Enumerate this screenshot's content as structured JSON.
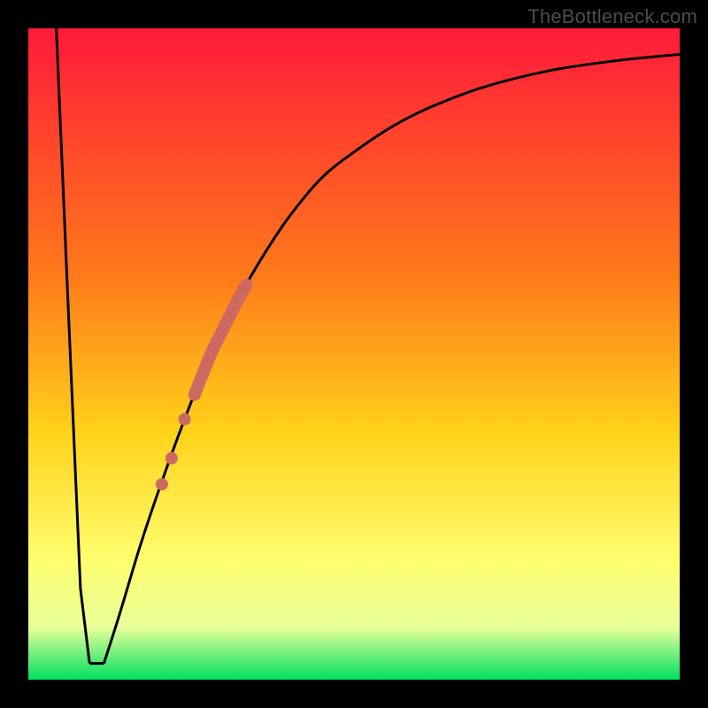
{
  "watermark": "TheBottleneck.com",
  "colors": {
    "frame": "#000000",
    "gradient_top": "#ff1a3a",
    "gradient_mid1": "#ff7a1a",
    "gradient_mid2": "#ffd21a",
    "gradient_mid3": "#ffff70",
    "gradient_mid4": "#e8ff9a",
    "gradient_bottom": "#00e060",
    "curve": "#000000",
    "markers": "#cc6a62"
  },
  "chart_data": {
    "type": "line",
    "title": "",
    "xlabel": "",
    "ylabel": "",
    "xlim": [
      0,
      100
    ],
    "ylim": [
      0,
      100
    ],
    "grid": false,
    "legend": false,
    "series": [
      {
        "name": "bottleneck_curve_left",
        "x": [
          4.3,
          6.0,
          8.0,
          9.4
        ],
        "values": [
          100,
          60,
          14,
          2.5
        ]
      },
      {
        "name": "bottleneck_curve_flat",
        "x": [
          9.4,
          11.6
        ],
        "values": [
          2.5,
          2.5
        ]
      },
      {
        "name": "bottleneck_curve_right",
        "x": [
          11.6,
          14,
          17,
          20,
          24,
          28,
          32,
          36,
          40,
          45,
          50,
          56,
          62,
          70,
          80,
          90,
          100
        ],
        "values": [
          2.5,
          10,
          20,
          29,
          40,
          50,
          58,
          65,
          71,
          77,
          81,
          85,
          88,
          91,
          93.5,
          95,
          96
        ]
      }
    ],
    "markers": {
      "name": "highlighted_segment",
      "x_range": [
        20,
        33
      ],
      "points": [
        {
          "x": 20.5,
          "y": 30
        },
        {
          "x": 22.0,
          "y": 34
        },
        {
          "x": 24.0,
          "y": 40
        },
        {
          "x": 33.0,
          "y": 60
        }
      ],
      "thick_band": {
        "x0": 25.5,
        "x1": 33.5
      }
    }
  }
}
